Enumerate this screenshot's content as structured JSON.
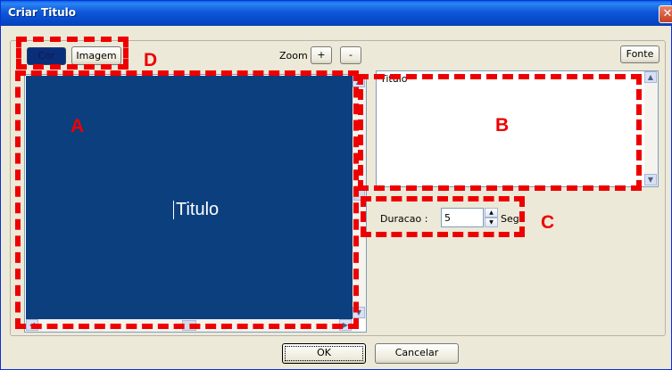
{
  "window": {
    "title": "Criar Titulo",
    "close_glyph": "✕"
  },
  "toolbar": {
    "cor_label": "Cor",
    "imagem_label": "Imagem",
    "zoom_label": "Zoom",
    "zoom_in_label": "+",
    "zoom_out_label": "-",
    "fonte_label": "Fonte"
  },
  "preview": {
    "title_text": "Titulo",
    "background_color": "#0c3f7d"
  },
  "text_editor": {
    "content": "Titulo"
  },
  "duration": {
    "label": "Duracao :",
    "value": "5",
    "unit": "Seg"
  },
  "footer": {
    "ok_label": "OK",
    "cancel_label": "Cancelar"
  },
  "annotations": {
    "a": "A",
    "b": "B",
    "c": "C",
    "d": "D",
    "color": "#ee0000"
  }
}
